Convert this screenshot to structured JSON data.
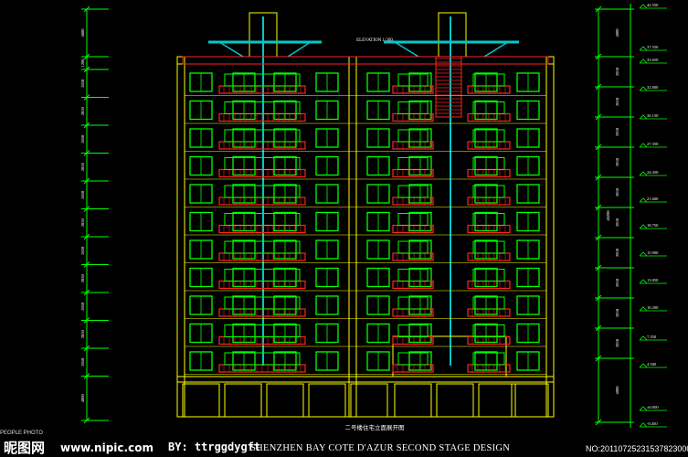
{
  "colors": {
    "background": "#000000",
    "wall": "#ffff00",
    "window": "#00ff00",
    "balcony": "#ff2222",
    "roof": "#00c8c8",
    "dimension": "#00ff00",
    "text": "#ffffff"
  },
  "drawing": {
    "chinese_title": "二号楼住宅立面展开图",
    "scale_label": "ELEVATION 1:200",
    "floors": 11,
    "left_dims": [
      "4000",
      "1200",
      "2850",
      "2850",
      "2850",
      "2850",
      "2850",
      "2850",
      "2850",
      "2850",
      "2850",
      "2850",
      "2850",
      "4000"
    ],
    "right_dims": [
      "4000",
      "2850",
      "2850",
      "2850",
      "2850",
      "2850",
      "2850",
      "2850",
      "2850",
      "2850",
      "2850",
      "4000"
    ],
    "right_total": "40200",
    "levels": [
      "42.550",
      "37.550",
      "35.650",
      "32.800",
      "30.150",
      "27.350",
      "24.450",
      "21.600",
      "18.750",
      "15.900",
      "13.050",
      "10.200",
      "7.350",
      "4.500",
      "±0.000",
      "-0.450"
    ]
  },
  "watermark": {
    "site_name": "昵图网",
    "site_url": "www.nipic.com",
    "author": "BY: ttrggdygft",
    "project_title": "SHENZHEN BAY COTE D'AZUR SECOND STAGE DESIGN",
    "image_no": "NO:20110725231537823000",
    "tiny_label": "PEOPLE PHOTO"
  }
}
